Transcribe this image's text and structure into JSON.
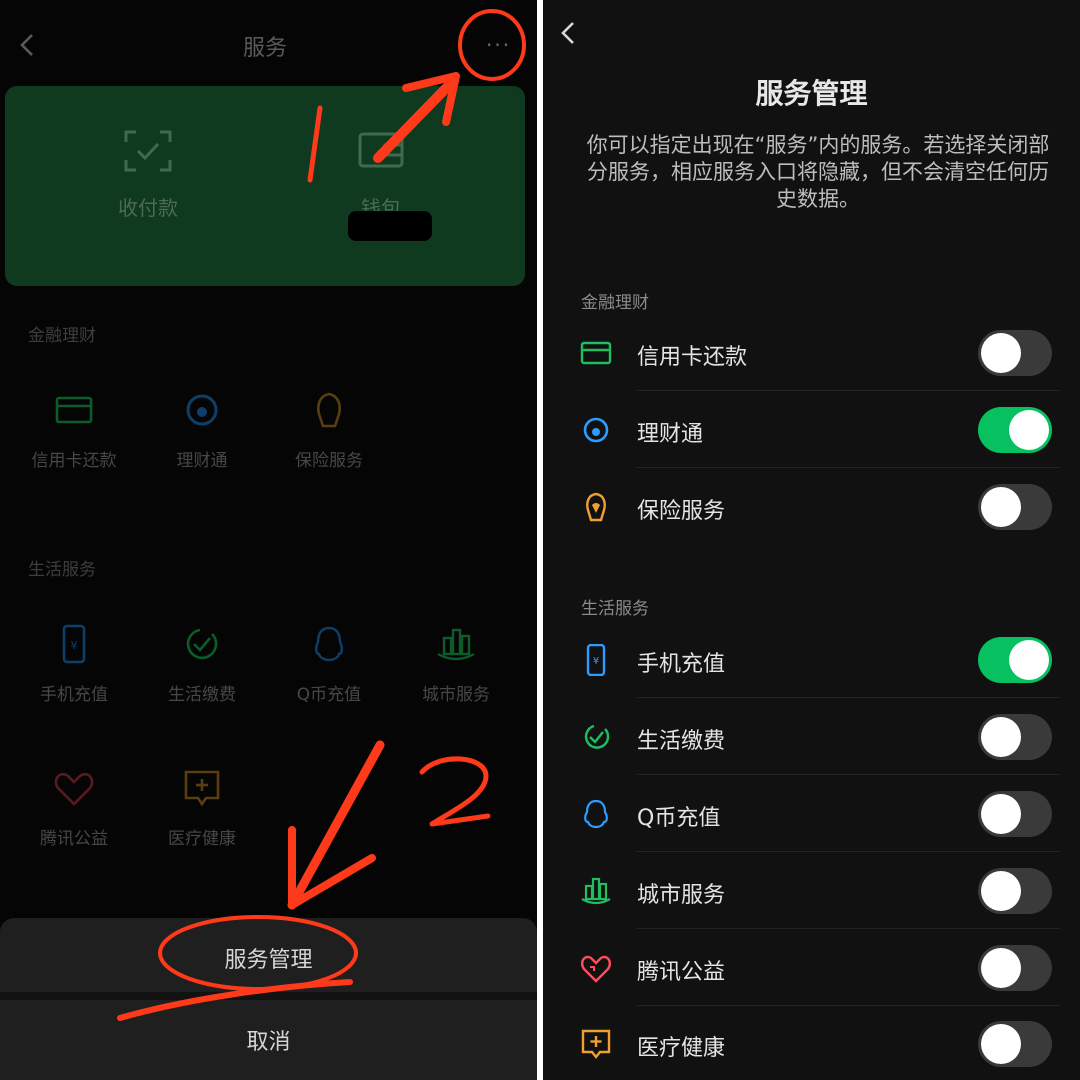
{
  "left": {
    "title": "服务",
    "more_label": "···",
    "wallet": {
      "pay_label": "收付款",
      "wallet_label": "钱包"
    },
    "finance": {
      "section_title": "金融理财",
      "items": [
        {
          "label": "信用卡还款",
          "icon": "credit-card-icon"
        },
        {
          "label": "理财通",
          "icon": "wealth-icon"
        },
        {
          "label": "保险服务",
          "icon": "insurance-icon"
        }
      ]
    },
    "life": {
      "section_title": "生活服务",
      "items": [
        {
          "label": "手机充值",
          "icon": "phone-topup-icon"
        },
        {
          "label": "生活缴费",
          "icon": "utility-icon"
        },
        {
          "label": "Q币充值",
          "icon": "qcoin-icon"
        },
        {
          "label": "城市服务",
          "icon": "city-icon"
        },
        {
          "label": "腾讯公益",
          "icon": "charity-icon"
        },
        {
          "label": "医疗健康",
          "icon": "medical-icon"
        }
      ]
    },
    "sheet": {
      "manage_label": "服务管理",
      "cancel_label": "取消"
    },
    "annotations": {
      "step1": "1",
      "step2": "2",
      "color": "#ff3a1a"
    }
  },
  "right": {
    "title": "服务管理",
    "description": "你可以指定出现在“服务”内的服务。若选择关闭部分服务，相应服务入口将隐藏，但不会清空任何历史数据。",
    "finance": {
      "section_title": "金融理财",
      "items": [
        {
          "label": "信用卡还款",
          "icon": "credit-card-icon",
          "enabled": false
        },
        {
          "label": "理财通",
          "icon": "wealth-icon",
          "enabled": true
        },
        {
          "label": "保险服务",
          "icon": "insurance-icon",
          "enabled": false
        }
      ]
    },
    "life": {
      "section_title": "生活服务",
      "items": [
        {
          "label": "手机充值",
          "icon": "phone-topup-icon",
          "enabled": true
        },
        {
          "label": "生活缴费",
          "icon": "utility-icon",
          "enabled": false
        },
        {
          "label": "Q币充值",
          "icon": "qcoin-icon",
          "enabled": false
        },
        {
          "label": "城市服务",
          "icon": "city-icon",
          "enabled": false
        },
        {
          "label": "腾讯公益",
          "icon": "charity-icon",
          "enabled": false
        },
        {
          "label": "医疗健康",
          "icon": "medical-icon",
          "enabled": false
        }
      ]
    }
  },
  "colors": {
    "toggle_on": "#07c160",
    "toggle_off": "#3a3a3a",
    "accent_green": "#07c160"
  }
}
